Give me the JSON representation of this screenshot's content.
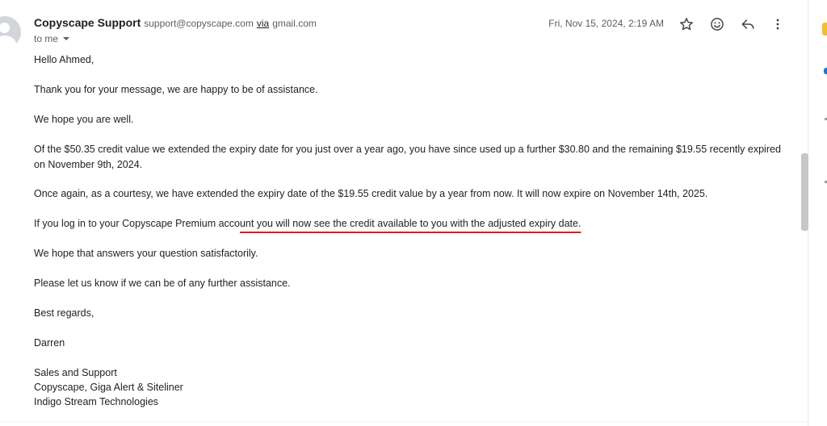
{
  "header": {
    "sender_name": "Copyscape Support",
    "sender_email": "support@copyscape.com",
    "via_label": "via",
    "via_domain": "gmail.com",
    "to_label": "to me",
    "date": "Fri, Nov 15, 2024, 2:19 AM",
    "icons": [
      "star-icon",
      "emoji-icon",
      "reply-icon",
      "more-icon"
    ]
  },
  "body": {
    "greeting": "Hello Ahmed,",
    "p1": "Thank you for your message, we are happy to be of assistance.",
    "p2": "We hope you are well.",
    "p3": "Of the $50.35 credit value we extended the expiry date for you just over a year ago, you have since used up a further $30.80 and the remaining $19.55 recently expired on November 9th, 2024.",
    "p4": "Once again, as a courtesy, we have extended the expiry date of the $19.55 credit value by a year from now. It will now expire on November 14th, 2025.",
    "p5_start": "If you log in to your Copyscape Premium acco",
    "p5_highlight": "unt you will now see the credit available to you with the adjusted expiry date.",
    "p6": "We hope that answers your question satisfactorily.",
    "p7": "Please let us know if we can be of any further assistance.",
    "closing": "Best regards,",
    "signature_name": "Darren",
    "sig_line1": "Sales and Support",
    "sig_line2": "Copyscape, Giga Alert & Siteliner",
    "sig_line3": "Indigo Stream Technologies"
  },
  "colors": {
    "annotation_underline": "#e31b1b",
    "scrollbar": "#c7c7c7",
    "side_yellow": "#f6bf26",
    "side_blue": "#1a73e8"
  }
}
